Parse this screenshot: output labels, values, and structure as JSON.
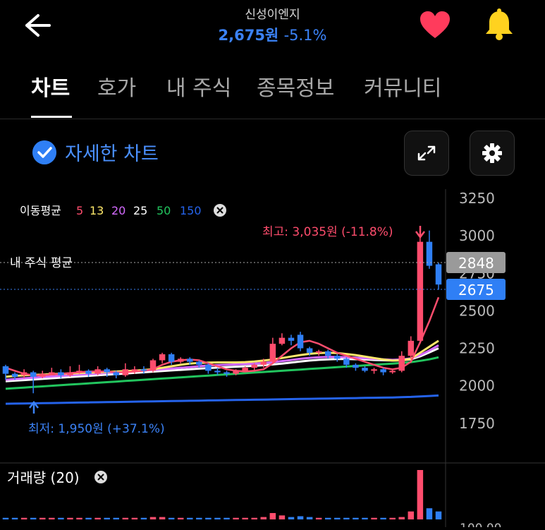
{
  "header": {
    "title": "신성이엔지",
    "price": "2,675원",
    "change": "-5.1%",
    "icons": {
      "back": "arrow-left-icon",
      "favorite": "heart-icon",
      "alert": "bell-icon"
    },
    "colors": {
      "heart": "#ff3b5c",
      "bell": "#ffd21f",
      "price": "#3b82f6"
    }
  },
  "tabs": [
    {
      "label": "차트",
      "active": true
    },
    {
      "label": "호가",
      "active": false
    },
    {
      "label": "내 주식",
      "active": false
    },
    {
      "label": "종목정보",
      "active": false
    },
    {
      "label": "커뮤니티",
      "active": false
    }
  ],
  "detail": {
    "label": "자세한 차트",
    "checked": true
  },
  "ma_legend": {
    "label": "이동평균",
    "periods": [
      {
        "value": "5",
        "color": "#ff4d6d"
      },
      {
        "value": "13",
        "color": "#ffe96b"
      },
      {
        "value": "20",
        "color": "#d46bff"
      },
      {
        "value": "25",
        "color": "#ffffff"
      },
      {
        "value": "50",
        "color": "#22c55e"
      },
      {
        "value": "150",
        "color": "#2563eb"
      }
    ]
  },
  "labels": {
    "high": "최고: 3,035원 (-11.8%)",
    "low": "최저: 1,950원 (+37.1%)",
    "my_avg": "내 주식 평균",
    "my_avg_value": "2848",
    "current_value": "2675",
    "volume_title": "거래량 (20)",
    "volume_axis_partial": "100,00"
  },
  "chart_data": {
    "type": "candlestick",
    "y_ticks": [
      3250,
      3000,
      2750,
      2500,
      2250,
      2000,
      1750
    ],
    "ylim": [
      1650,
      3250
    ],
    "my_average": 2848,
    "current": 2675,
    "high": 3035,
    "low": 1950,
    "candles": [
      [
        2130,
        2080,
        2140,
        2040
      ],
      [
        2080,
        2060,
        2090,
        2040
      ],
      [
        2070,
        2090,
        2110,
        2050
      ],
      [
        2090,
        2060,
        2100,
        1950
      ],
      [
        2060,
        2080,
        2100,
        2050
      ],
      [
        2080,
        2090,
        2120,
        2070
      ],
      [
        2090,
        2070,
        2110,
        2050
      ],
      [
        2070,
        2090,
        2130,
        2060
      ],
      [
        2090,
        2100,
        2140,
        2080
      ],
      [
        2100,
        2080,
        2110,
        2060
      ],
      [
        2080,
        2110,
        2130,
        2070
      ],
      [
        2110,
        2090,
        2120,
        2060
      ],
      [
        2090,
        2070,
        2100,
        2050
      ],
      [
        2070,
        2110,
        2150,
        2060
      ],
      [
        2110,
        2110,
        2130,
        2080
      ],
      [
        2110,
        2100,
        2130,
        2080
      ],
      [
        2100,
        2170,
        2180,
        2090
      ],
      [
        2170,
        2210,
        2220,
        2150
      ],
      [
        2210,
        2160,
        2220,
        2140
      ],
      [
        2160,
        2180,
        2190,
        2150
      ],
      [
        2180,
        2160,
        2190,
        2140
      ],
      [
        2160,
        2140,
        2170,
        2120
      ],
      [
        2140,
        2100,
        2150,
        2080
      ],
      [
        2100,
        2090,
        2120,
        2070
      ],
      [
        2090,
        2080,
        2100,
        2060
      ],
      [
        2080,
        2100,
        2110,
        2070
      ],
      [
        2100,
        2120,
        2130,
        2090
      ],
      [
        2120,
        2140,
        2150,
        2100
      ],
      [
        2140,
        2160,
        2180,
        2120
      ],
      [
        2160,
        2280,
        2320,
        2150
      ],
      [
        2280,
        2320,
        2350,
        2270
      ],
      [
        2320,
        2300,
        2340,
        2270
      ],
      [
        2340,
        2250,
        2360,
        2230
      ],
      [
        2250,
        2220,
        2260,
        2200
      ],
      [
        2220,
        2230,
        2240,
        2200
      ],
      [
        2230,
        2200,
        2240,
        2180
      ],
      [
        2200,
        2180,
        2210,
        2160
      ],
      [
        2180,
        2140,
        2190,
        2120
      ],
      [
        2140,
        2120,
        2150,
        2100
      ],
      [
        2120,
        2100,
        2130,
        2090
      ],
      [
        2100,
        2110,
        2120,
        2080
      ],
      [
        2110,
        2090,
        2120,
        2070
      ],
      [
        2090,
        2100,
        2110,
        2080
      ],
      [
        2100,
        2200,
        2230,
        2090
      ],
      [
        2200,
        2300,
        2330,
        2180
      ],
      [
        2300,
        2960,
        3000,
        2280
      ],
      [
        2960,
        2800,
        3035,
        2780
      ],
      [
        2810,
        2675,
        2820,
        2640
      ]
    ],
    "ma5": [
      2120,
      2100,
      2080,
      2070,
      2070,
      2075,
      2080,
      2085,
      2090,
      2095,
      2095,
      2095,
      2090,
      2090,
      2095,
      2100,
      2110,
      2140,
      2160,
      2170,
      2175,
      2170,
      2150,
      2130,
      2110,
      2100,
      2095,
      2100,
      2110,
      2150,
      2200,
      2250,
      2290,
      2300,
      2280,
      2250,
      2220,
      2200,
      2180,
      2160,
      2140,
      2120,
      2110,
      2120,
      2160,
      2290,
      2430,
      2590
    ],
    "ma13": [
      2060,
      2065,
      2070,
      2072,
      2075,
      2078,
      2080,
      2082,
      2085,
      2088,
      2090,
      2092,
      2095,
      2098,
      2100,
      2105,
      2110,
      2120,
      2130,
      2140,
      2148,
      2152,
      2155,
      2156,
      2156,
      2156,
      2158,
      2162,
      2168,
      2175,
      2185,
      2195,
      2205,
      2213,
      2218,
      2220,
      2218,
      2212,
      2205,
      2195,
      2185,
      2175,
      2168,
      2170,
      2180,
      2220,
      2260,
      2300
    ],
    "ma20": [
      2040,
      2045,
      2050,
      2054,
      2058,
      2062,
      2066,
      2070,
      2074,
      2078,
      2082,
      2086,
      2090,
      2094,
      2098,
      2102,
      2106,
      2110,
      2115,
      2120,
      2125,
      2130,
      2135,
      2138,
      2140,
      2142,
      2145,
      2148,
      2152,
      2158,
      2165,
      2172,
      2180,
      2186,
      2190,
      2192,
      2192,
      2190,
      2188,
      2184,
      2180,
      2176,
      2173,
      2175,
      2182,
      2205,
      2235,
      2270
    ],
    "ma25": [
      2030,
      2034,
      2038,
      2042,
      2046,
      2050,
      2054,
      2058,
      2062,
      2066,
      2070,
      2074,
      2078,
      2082,
      2086,
      2090,
      2094,
      2098,
      2102,
      2106,
      2110,
      2114,
      2118,
      2121,
      2124,
      2127,
      2130,
      2133,
      2137,
      2142,
      2148,
      2155,
      2162,
      2168,
      2173,
      2176,
      2178,
      2178,
      2177,
      2175,
      2172,
      2170,
      2168,
      2170,
      2176,
      2196,
      2222,
      2250
    ],
    "ma50": [
      1980,
      1984,
      1988,
      1992,
      1996,
      2000,
      2004,
      2008,
      2012,
      2016,
      2020,
      2024,
      2028,
      2032,
      2036,
      2040,
      2044,
      2048,
      2052,
      2056,
      2060,
      2064,
      2068,
      2072,
      2076,
      2080,
      2084,
      2088,
      2092,
      2096,
      2100,
      2104,
      2108,
      2112,
      2116,
      2120,
      2124,
      2128,
      2132,
      2136,
      2140,
      2144,
      2148,
      2152,
      2158,
      2166,
      2176,
      2190
    ],
    "ma150": [
      1880,
      1881,
      1882,
      1883,
      1884,
      1885,
      1886,
      1887,
      1888,
      1889,
      1890,
      1891,
      1892,
      1893,
      1894,
      1895,
      1896,
      1897,
      1898,
      1899,
      1900,
      1901,
      1902,
      1903,
      1904,
      1905,
      1906,
      1907,
      1908,
      1909,
      1910,
      1911,
      1912,
      1913,
      1914,
      1915,
      1916,
      1917,
      1918,
      1919,
      1920,
      1921,
      1922,
      1924,
      1926,
      1929,
      1932,
      1935
    ],
    "volume": [
      2,
      2,
      2,
      2,
      2,
      2,
      2,
      2,
      2,
      2,
      2,
      2,
      2,
      2,
      2,
      2,
      3,
      3,
      2,
      2,
      2,
      2,
      2,
      2,
      2,
      2,
      2,
      2,
      3,
      8,
      5,
      3,
      4,
      3,
      2,
      2,
      2,
      2,
      2,
      2,
      2,
      2,
      2,
      3,
      10,
      62,
      14,
      10
    ]
  }
}
